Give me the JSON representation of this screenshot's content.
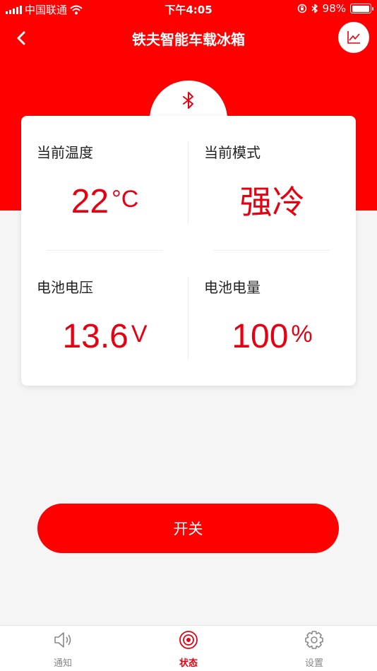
{
  "status_bar": {
    "carrier": "中国联通",
    "time": "下午4:05",
    "battery_text": "98%",
    "battery_level": 0.98
  },
  "header": {
    "title": "铁夫智能车载冰箱",
    "back_icon": "chevron-left-icon",
    "chart_icon": "line-chart-icon"
  },
  "bluetooth_icon": "bluetooth-icon",
  "metrics": {
    "temperature": {
      "label": "当前温度",
      "value": "22",
      "unit": "°C"
    },
    "mode": {
      "label": "当前模式",
      "value": "强冷"
    },
    "voltage": {
      "label": "电池电压",
      "value": "13.6",
      "unit": "V"
    },
    "battery": {
      "label": "电池电量",
      "value": "100",
      "unit": "%"
    }
  },
  "switch_button": {
    "label": "开关"
  },
  "tabs": [
    {
      "label": "通知",
      "icon": "speaker-icon",
      "active": false
    },
    {
      "label": "状态",
      "icon": "status-target-icon",
      "active": true
    },
    {
      "label": "设置",
      "icon": "gear-icon",
      "active": false
    }
  ],
  "colors": {
    "primary_red": "#ff0000",
    "value_red": "#e60012",
    "background": "#f5f5f5"
  }
}
